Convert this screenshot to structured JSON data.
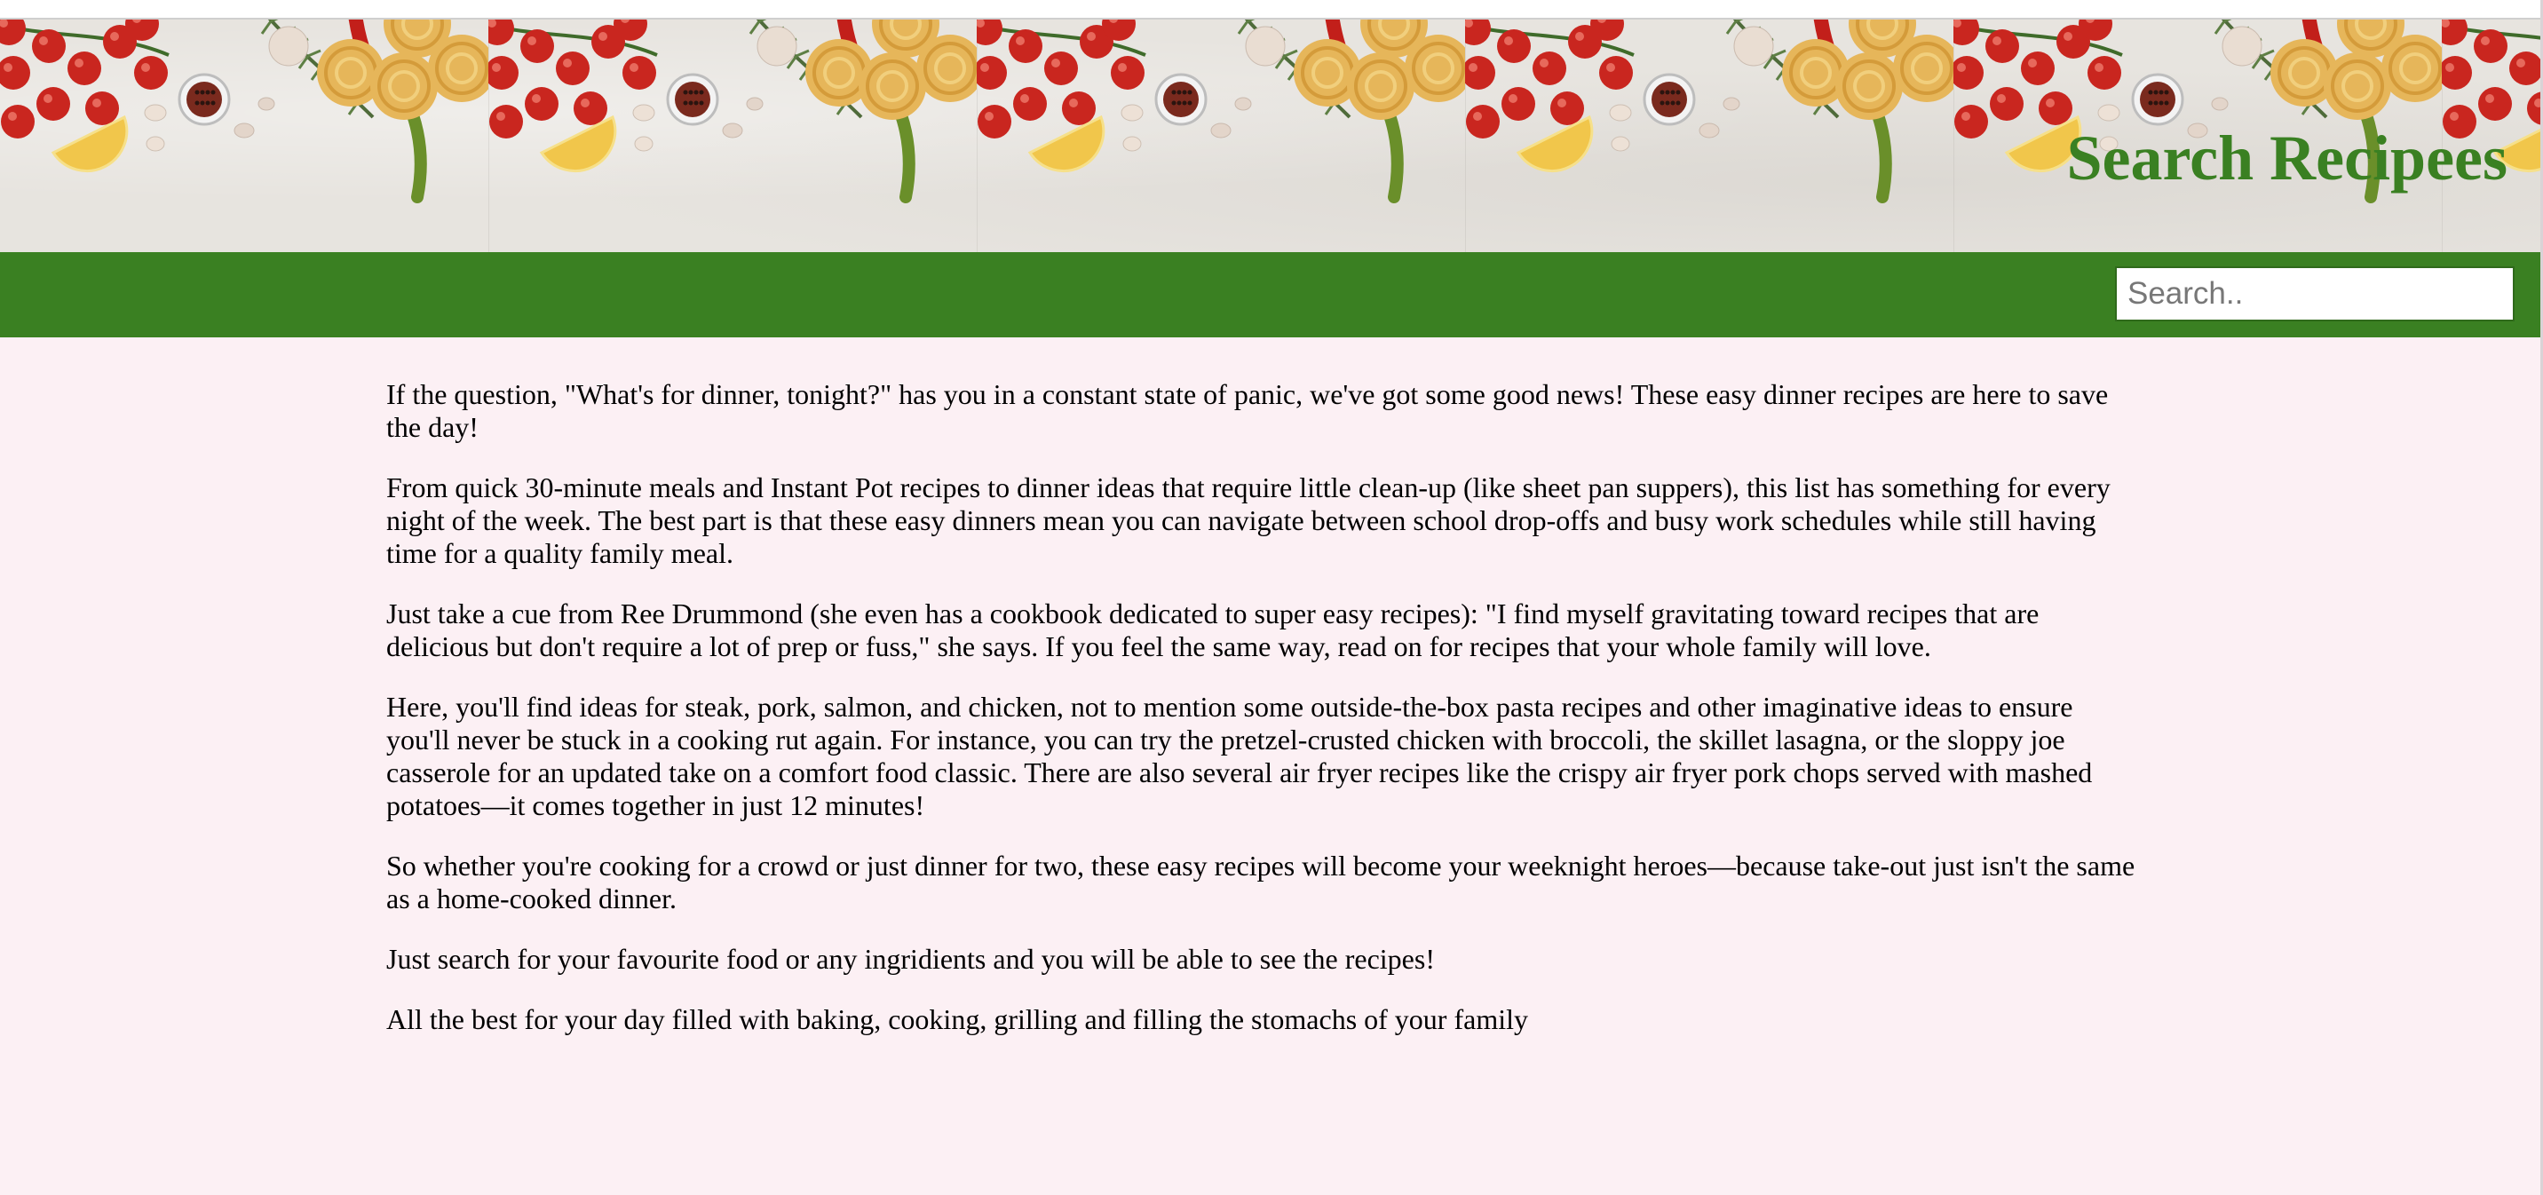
{
  "header": {
    "title": "Search Recipees"
  },
  "search": {
    "placeholder": "Search..",
    "value": "",
    "icon": "search-icon"
  },
  "colors": {
    "accent": "#3a8022",
    "background": "#fcf0f4"
  },
  "main": {
    "paragraphs": [
      "If the question, \"What's for dinner, tonight?\" has you in a constant state of panic, we've got some good news! These easy dinner recipes are here to save the day!",
      "From quick 30-minute meals and Instant Pot recipes to dinner ideas that require little clean-up (like sheet pan suppers), this list has something for every night of the week. The best part is that these easy dinners mean you can navigate between school drop-offs and busy work schedules while still having time for a quality family meal.",
      "Just take a cue from Ree Drummond (she even has a cookbook dedicated to super easy recipes): \"I find myself gravitating toward recipes that are delicious but don't require a lot of prep or fuss,\" she says. If you feel the same way, read on for recipes that your whole family will love.",
      "Here, you'll find ideas for steak, pork, salmon, and chicken, not to mention some outside-the-box pasta recipes and other imaginative ideas to ensure you'll never be stuck in a cooking rut again. For instance, you can try the pretzel-crusted chicken with broccoli, the skillet lasagna, or the sloppy joe casserole for an updated take on a comfort food classic. There are also several air fryer recipes like the crispy air fryer pork chops served with mashed potatoes—it comes together in just 12 minutes!",
      "So whether you're cooking for a crowd or just dinner for two, these easy recipes will become your weeknight heroes—because take-out just isn't the same as a home-cooked dinner.",
      "Just search for your favourite food or any ingridients and you will be able to see the recipes!",
      "All the best for your day filled with baking, cooking, grilling and filling the stomachs of your family"
    ]
  }
}
